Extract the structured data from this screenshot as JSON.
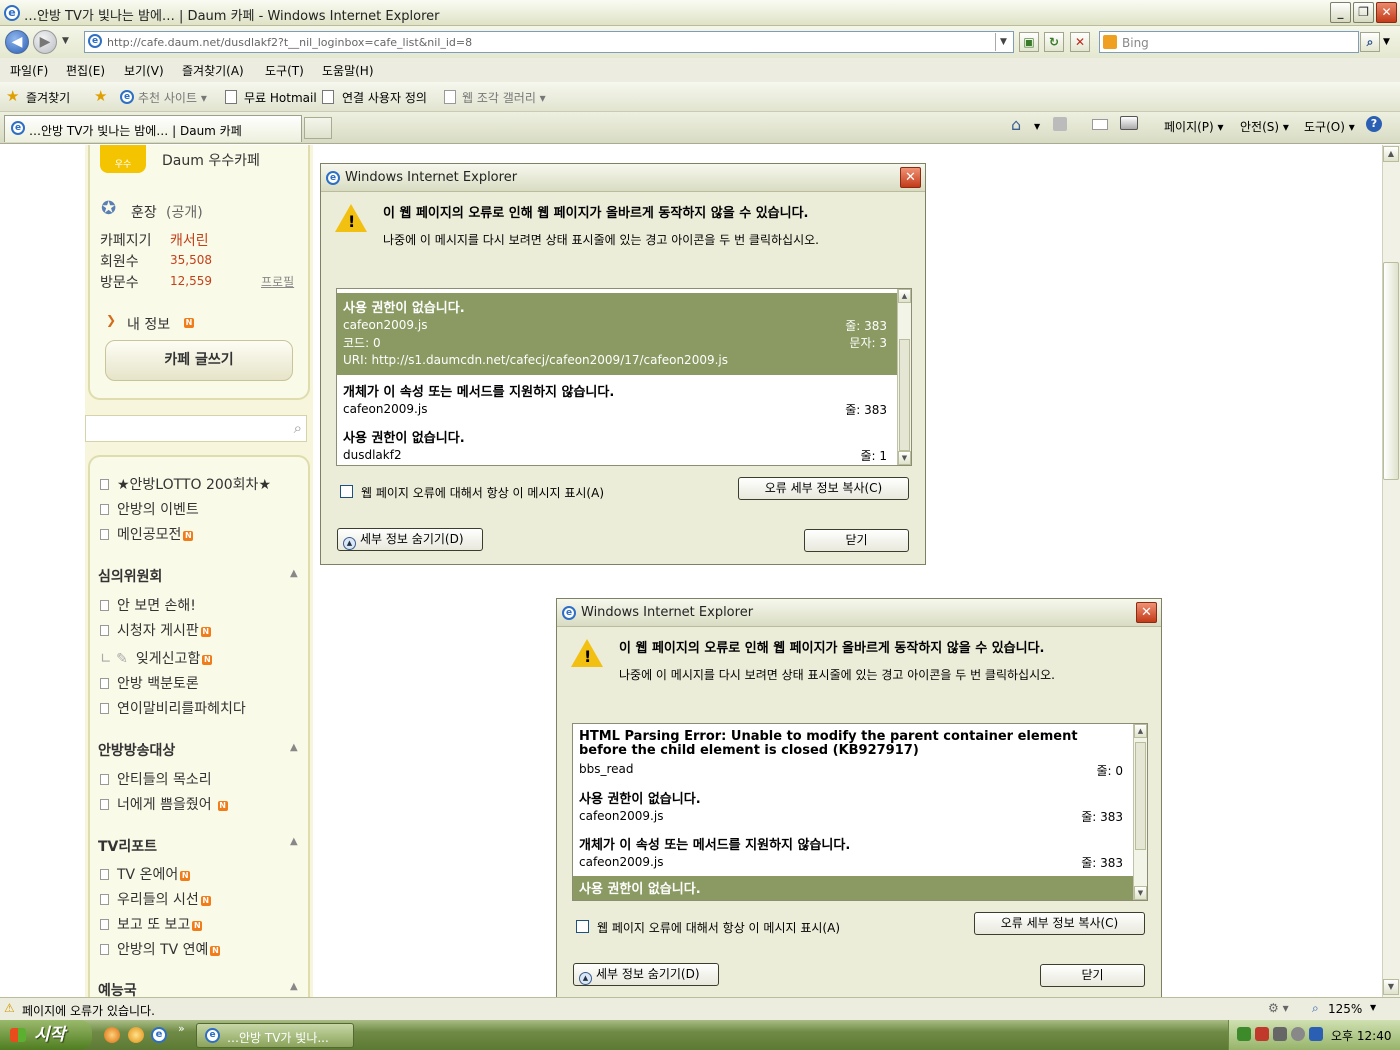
{
  "window": {
    "title": "…안방 TV가 빛나는 밤에… | Daum 카페 - Windows Internet Explorer"
  },
  "address": {
    "url": "http://cafe.daum.net/dusdlakf2?t__nil_loginbox=cafe_list&nil_id=8",
    "search_placeholder": "Bing"
  },
  "menu": [
    "파일(F)",
    "편집(E)",
    "보기(V)",
    "즐겨찾기(A)",
    "도구(T)",
    "도움말(H)"
  ],
  "favorites": {
    "label": "즐겨찾기",
    "items": [
      "추천 사이트 ▾",
      "무료 Hotmail",
      "연결 사용자 정의",
      "웹 조각 갤러리 ▾"
    ]
  },
  "tab": {
    "title": "…안방 TV가 빛나는 밤에… | Daum 카페"
  },
  "commands": [
    "페이지(P) ▾",
    "안전(S) ▾",
    "도구(O) ▾"
  ],
  "sidebar": {
    "badge": "우수",
    "cafe_title": "Daum 우수카페",
    "leader": "훈장",
    "leader_status": "(공개)",
    "stats": [
      {
        "label": "카페지기",
        "value": "캐서린"
      },
      {
        "label": "회원수",
        "value": "35,508"
      },
      {
        "label": "방문수",
        "value": "12,559"
      }
    ],
    "profile_link": "프로필",
    "my_info": "내 정보",
    "write_button": "카페 글쓰기",
    "menu_top": [
      "★안방LOTTO 200회차★",
      "안방의 이벤트",
      "메인공모전"
    ],
    "groups": [
      {
        "name": "심의위원회",
        "items": [
          "안 보면 손해!",
          "시청자 게시판",
          "잊게신고함",
          "안방 백분토론",
          "연이말비리를파헤치다"
        ]
      },
      {
        "name": "안방방송대상",
        "items": [
          "안티들의 목소리",
          "너에게 쁨을줬어"
        ]
      },
      {
        "name": "TV리포트",
        "items": [
          "TV 온에어",
          "우리들의 시선",
          "보고 또 보고",
          "안방의 TV 연예"
        ]
      },
      {
        "name": "예능국",
        "items": []
      }
    ]
  },
  "dialog1": {
    "title": "Windows Internet Explorer",
    "heading": "이 웹 페이지의 오류로 인해 웹 페이지가 올바르게 동작하지 않을 수 있습니다.",
    "sub": "나중에 이 메시지를 다시 보려면 상태 표시줄에 있는 경고 아이콘을 두 번 클릭하십시오.",
    "errors": [
      {
        "title": "사용 권한이 없습니다.",
        "file": "cafeon2009.js",
        "line": "줄: 383",
        "code": "코드: 0",
        "char": "문자: 3",
        "uri": "URI: http://s1.daumcdn.net/cafecj/cafeon2009/17/cafeon2009.js"
      },
      {
        "title": "개체가 이 속성 또는 메서드를 지원하지 않습니다.",
        "file": "cafeon2009.js",
        "line": "줄: 383"
      },
      {
        "title": "사용 권한이 없습니다.",
        "file": "dusdlakf2",
        "line": "줄: 1"
      }
    ],
    "checkbox": "웹 페이지 오류에 대해서 항상 이 메시지 표시(A)",
    "copy_button": "오류 세부 정보 복사(C)",
    "hide_button": "세부 정보 숨기기(D)",
    "close_button": "닫기"
  },
  "dialog2": {
    "title": "Windows Internet Explorer",
    "heading": "이 웹 페이지의 오류로 인해 웹 페이지가 올바르게 동작하지 않을 수 있습니다.",
    "sub": "나중에 이 메시지를 다시 보려면 상태 표시줄에 있는 경고 아이콘을 두 번 클릭하십시오.",
    "errors": [
      {
        "title": "HTML Parsing Error: Unable to modify the parent container element before the child element is closed (KB927917)",
        "file": "bbs_read",
        "line": "줄: 0"
      },
      {
        "title": "사용 권한이 없습니다.",
        "file": "cafeon2009.js",
        "line": "줄: 383"
      },
      {
        "title": "개체가 이 속성 또는 메서드를 지원하지 않습니다.",
        "file": "cafeon2009.js",
        "line": "줄: 383"
      },
      {
        "title": "사용 권한이 없습니다.",
        "file": "",
        "line": ""
      }
    ],
    "checkbox": "웹 페이지 오류에 대해서 항상 이 메시지 표시(A)",
    "copy_button": "오류 세부 정보 복사(C)",
    "hide_button": "세부 정보 숨기기(D)",
    "close_button": "닫기"
  },
  "statusbar": {
    "text": "페이지에 오류가 있습니다.",
    "zoom": "125%"
  },
  "taskbar": {
    "start": "시작",
    "task": "…안방 TV가 빛나...",
    "clock": "오후 12:40"
  },
  "colors": {
    "selected_error": "#8a9a62",
    "sidebar_bg": "#f7f6dc",
    "accent_orange": "#c3411a"
  }
}
